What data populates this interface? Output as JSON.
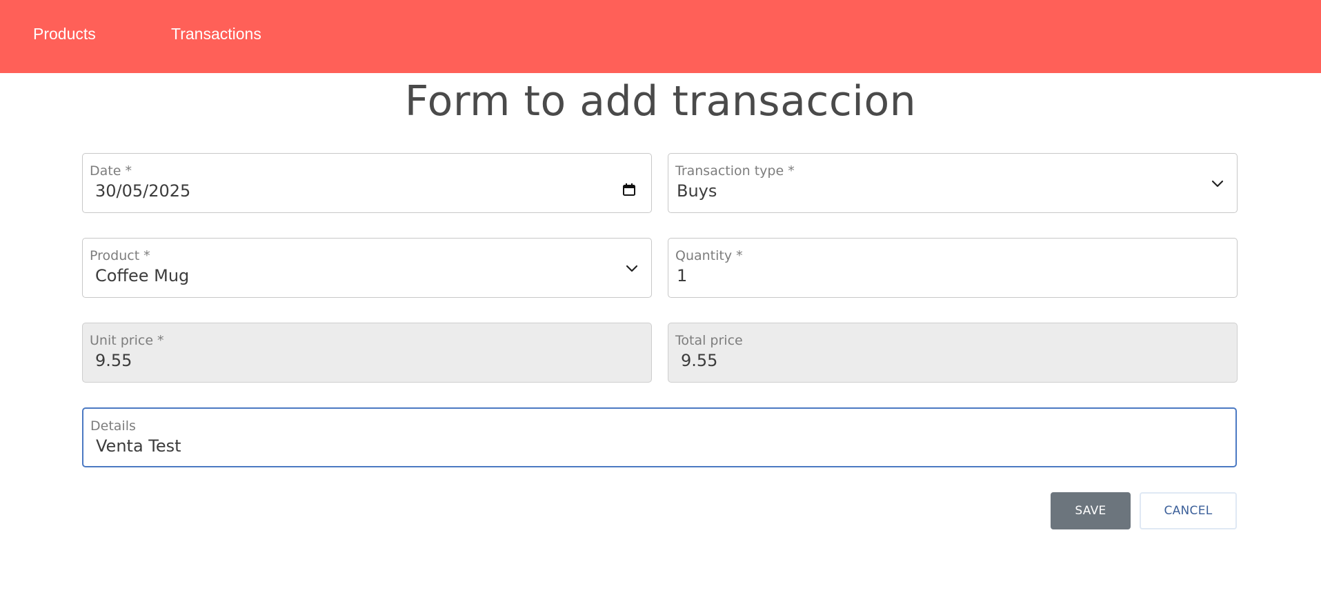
{
  "nav": {
    "products": "Products",
    "transactions": "Transactions",
    "background_color": "#ff6058"
  },
  "page": {
    "title": "Form to add transaccion"
  },
  "form": {
    "date": {
      "label": "Date *",
      "value": "30/05/2025",
      "icon": "calendar-icon"
    },
    "transaction_type": {
      "label": "Transaction type *",
      "value": "Buys",
      "icon": "chevron-down-icon"
    },
    "product": {
      "label": "Product *",
      "value": "Coffee Mug",
      "icon": "chevron-down-icon"
    },
    "quantity": {
      "label": "Quantity *",
      "value": "1"
    },
    "unit_price": {
      "label": "Unit price *",
      "value": "9.55"
    },
    "total_price": {
      "label": "Total price",
      "value": "9.55"
    },
    "details": {
      "label": "Details",
      "value": "Venta Test"
    }
  },
  "actions": {
    "save": "SAVE",
    "cancel": "CANCEL",
    "save_color": "#6c757d",
    "focus_color": "#4a78c2"
  }
}
